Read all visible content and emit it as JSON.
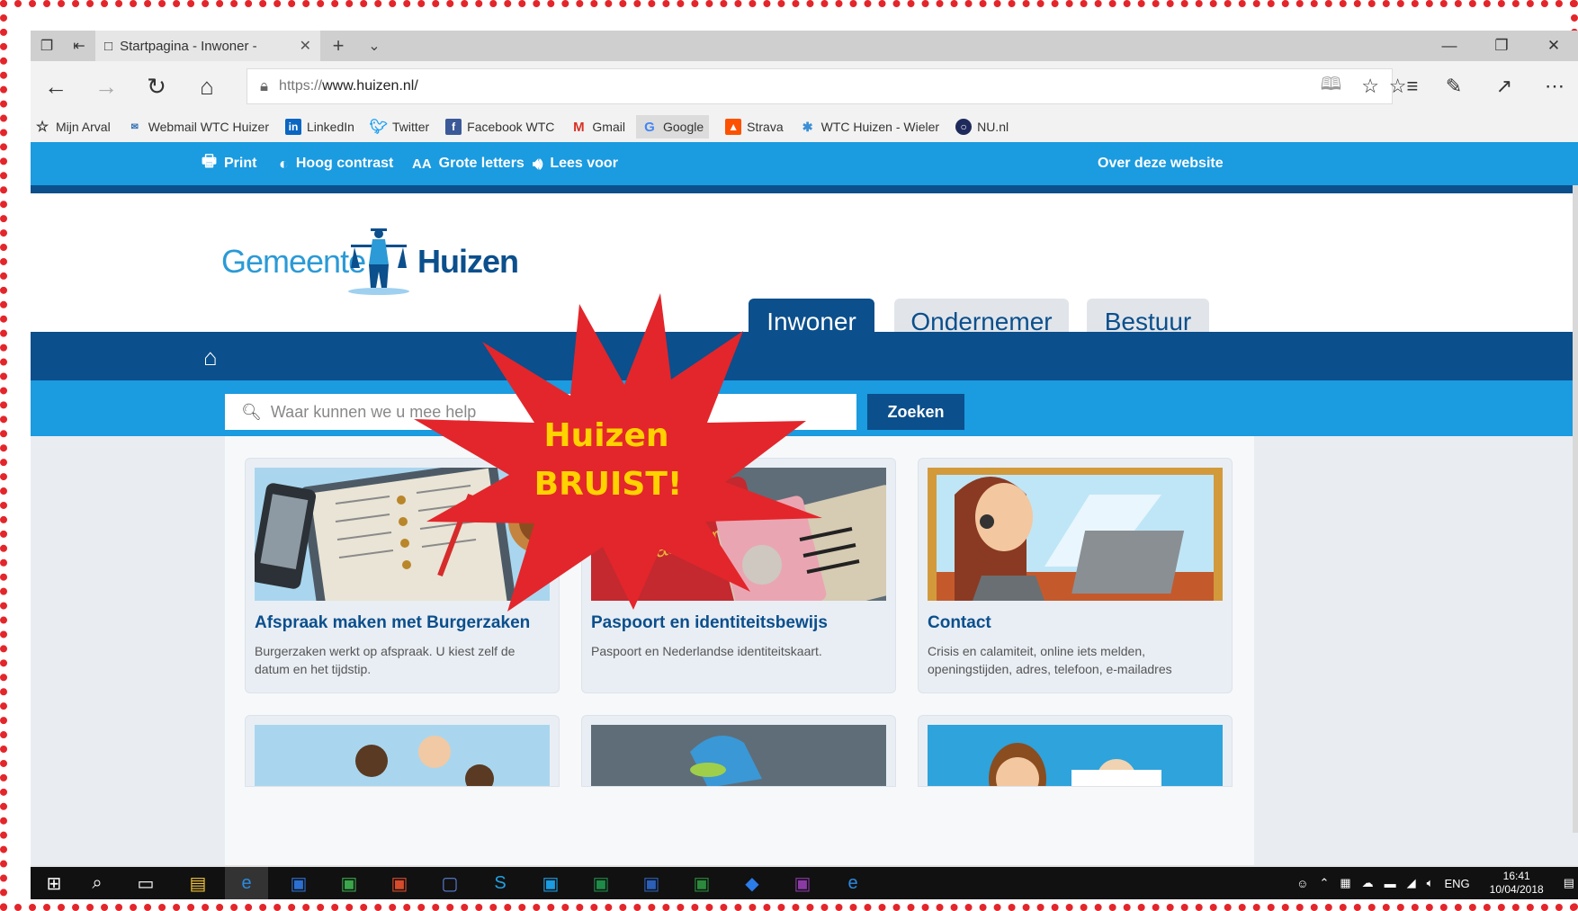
{
  "browser": {
    "tab_title": "Startpagina - Inwoner -",
    "url_prefix": "https://",
    "url_host": "www.huizen.nl/",
    "favorites": [
      {
        "label": "Mijn Arval",
        "icon": "star-icon",
        "color": "#ffffff"
      },
      {
        "label": "Webmail WTC Huizer",
        "icon": "mail-icon",
        "color": "#2b6cb0"
      },
      {
        "label": "LinkedIn",
        "icon": "linkedin-icon",
        "color": "#0a66c2"
      },
      {
        "label": "Twitter",
        "icon": "twitter-icon",
        "color": "#1da1f2"
      },
      {
        "label": "Facebook WTC",
        "icon": "facebook-icon",
        "color": "#3b5998"
      },
      {
        "label": "Gmail",
        "icon": "gmail-icon",
        "color": "#d93025"
      },
      {
        "label": "Google",
        "icon": "google-icon",
        "color": "#4285f4"
      },
      {
        "label": "Strava",
        "icon": "strava-icon",
        "color": "#fc5200"
      },
      {
        "label": "WTC Huizen - Wieler",
        "icon": "wtc-icon",
        "color": "#3a8fd6"
      },
      {
        "label": "NU.nl",
        "icon": "nu-icon",
        "color": "#1f2a5c"
      }
    ]
  },
  "site": {
    "toolbar": {
      "print": "Print",
      "contrast": "Hoog contrast",
      "large_text": "Grote letters",
      "read_aloud": "Lees voor",
      "about": "Over deze website"
    },
    "logo": {
      "word1": "Gemeente",
      "word2": "Huizen"
    },
    "tabs": [
      {
        "label": "Inwoner",
        "active": true
      },
      {
        "label": "Ondernemer",
        "active": false
      },
      {
        "label": "Bestuur",
        "active": false
      }
    ],
    "search": {
      "placeholder": "Waar kunnen we u mee help",
      "button": "Zoeken"
    },
    "burst": {
      "line1": "Huizen",
      "line2": "BRUIST!"
    },
    "cards": [
      {
        "title": "Afspraak maken met Burgerzaken",
        "desc": "Burgerzaken werkt op afspraak. U kiest zelf de datum en het tijdstip."
      },
      {
        "title": "Paspoort en identiteitsbewijs",
        "desc": "Paspoort en Nederlandse identiteitskaart."
      },
      {
        "title": "Contact",
        "desc": "Crisis en calamiteit, online iets melden, openingstijden, adres, telefoon, e-mailadres"
      }
    ],
    "passport_word": "paspoort",
    "colors": {
      "accent": "#1b9be0",
      "dark": "#0b4f8c",
      "burst": "#e3262b",
      "burst_text": "#ffd200"
    }
  },
  "taskbar": {
    "lang": "ENG",
    "time": "16:41",
    "date": "10/04/2018"
  }
}
